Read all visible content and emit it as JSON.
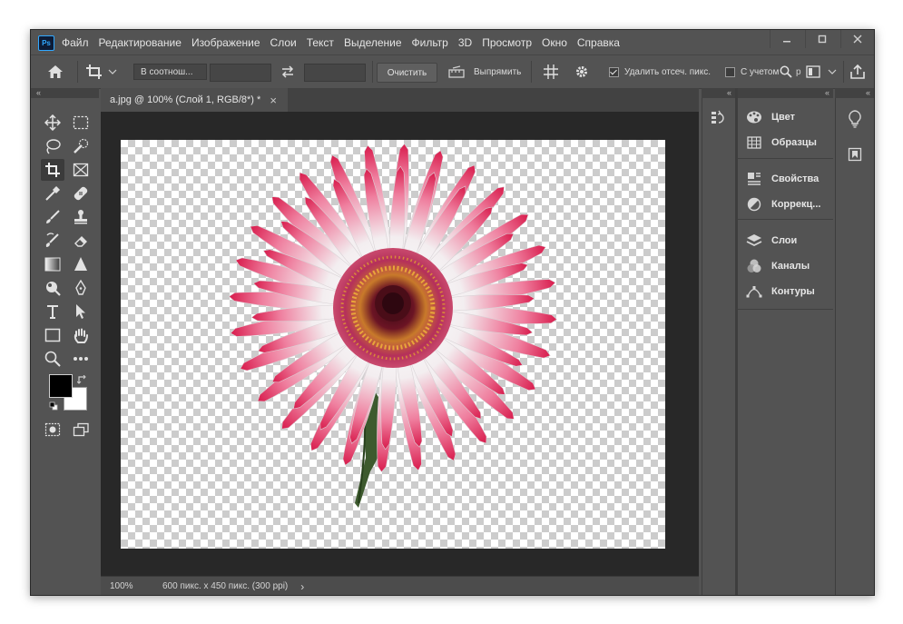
{
  "app": {
    "logo": "Ps"
  },
  "menu": [
    "Файл",
    "Редактирование",
    "Изображение",
    "Слои",
    "Текст",
    "Выделение",
    "Фильтр",
    "3D",
    "Просмотр",
    "Окно",
    "Справка"
  ],
  "window_controls": {
    "minimize": "minimize-icon",
    "maximize": "maximize-icon",
    "close": "close-icon"
  },
  "options": {
    "ratio_select": "В соотнош...",
    "clear_button": "Очистить",
    "straighten_button": "Выпрямить",
    "delete_cropped": "Удалить отсеч. пикс.",
    "delete_cropped_checked": true,
    "content_aware": "С учетом",
    "content_aware_checked": false,
    "search_extra": "р"
  },
  "collapse": {
    "left": "«",
    "mid": "«",
    "right1": "«",
    "right2": "«"
  },
  "document": {
    "tab_title": "a.jpg @ 100% (Слой 1, RGB/8*) *",
    "tab_close": "×"
  },
  "status": {
    "zoom": "100%",
    "info": "600 пикс. x 450 пикс. (300 ppi)",
    "arrow": "›"
  },
  "colors": {
    "foreground": "#000000",
    "background": "#ffffff",
    "accent": "#31a8ff"
  },
  "panels": {
    "group1": [
      {
        "label": "Цвет",
        "icon": "palette-icon"
      },
      {
        "label": "Образцы",
        "icon": "grid-icon"
      }
    ],
    "group2": [
      {
        "label": "Свойства",
        "icon": "properties-icon"
      },
      {
        "label": "Коррекц...",
        "icon": "adjustments-icon"
      }
    ],
    "group3": [
      {
        "label": "Слои",
        "icon": "layers-icon"
      },
      {
        "label": "Каналы",
        "icon": "channels-icon"
      },
      {
        "label": "Контуры",
        "icon": "paths-icon"
      }
    ]
  }
}
